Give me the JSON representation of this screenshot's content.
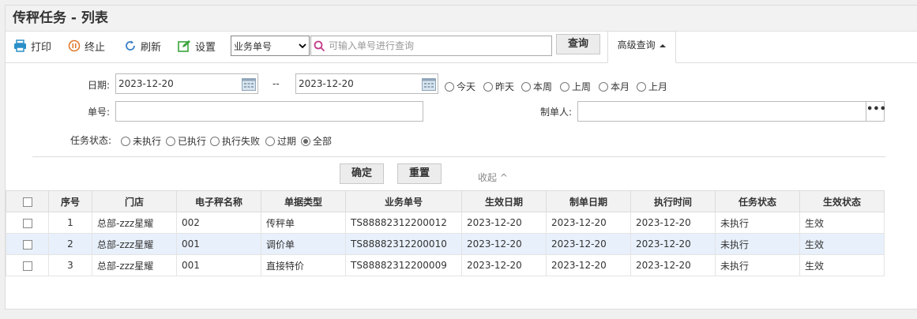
{
  "title": "传秤任务 - 列表",
  "toolbar": {
    "print": "打印",
    "stop": "终止",
    "refresh": "刷新",
    "settings": "设置",
    "search_field": "业务单号",
    "search_placeholder": "可输入单号进行查询",
    "query": "查询",
    "advanced": "高级查询"
  },
  "filter": {
    "date_label": "日期:",
    "date_from": "2023-12-20",
    "date_sep": "--",
    "date_to": "2023-12-20",
    "quick_dates": [
      "今天",
      "昨天",
      "本周",
      "上周",
      "本月",
      "上月"
    ],
    "bill_label": "单号:",
    "bill_value": "",
    "maker_label": "制单人:",
    "maker_value": "",
    "maker_btn": "•••",
    "status_label": "任务状态:",
    "status_options": [
      "未执行",
      "已执行",
      "执行失败",
      "过期",
      "全部"
    ],
    "status_selected": "全部",
    "confirm": "确定",
    "reset": "重置",
    "collapse": "收起 ^"
  },
  "table": {
    "headers": [
      "序号",
      "门店",
      "电子秤名称",
      "单据类型",
      "业务单号",
      "生效日期",
      "制单日期",
      "执行时间",
      "任务状态",
      "生效状态"
    ],
    "rows": [
      [
        "1",
        "总部-zzz星耀",
        "002",
        "传秤单",
        "TS88882312200012",
        "2023-12-20",
        "2023-12-20",
        "2023-12-20",
        "未执行",
        "生效"
      ],
      [
        "2",
        "总部-zzz星耀",
        "001",
        "调价单",
        "TS88882312200010",
        "2023-12-20",
        "2023-12-20",
        "2023-12-20",
        "未执行",
        "生效"
      ],
      [
        "3",
        "总部-zzz星耀",
        "001",
        "直接特价",
        "TS88882312200009",
        "2023-12-20",
        "2023-12-20",
        "2023-12-20",
        "未执行",
        "生效"
      ]
    ]
  },
  "colors": {
    "print": "#2a8fc9",
    "stop": "#e07a2e",
    "refresh": "#3c7ec4",
    "settings": "#3aa33a",
    "search": "#c23a8a"
  }
}
